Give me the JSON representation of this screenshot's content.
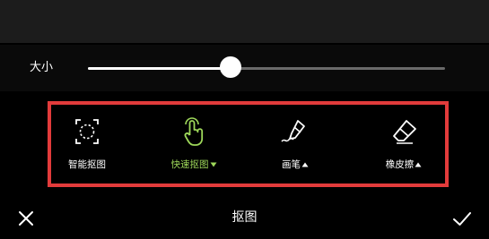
{
  "slider": {
    "label": "大小",
    "value": 0.4
  },
  "tools": [
    {
      "label": "智能抠图",
      "icon": "dashed-circle-selection-icon",
      "caret": "",
      "active": false
    },
    {
      "label": "快速抠图",
      "icon": "finger-tap-icon",
      "caret": "down",
      "active": true
    },
    {
      "label": "画笔",
      "icon": "brush-icon",
      "caret": "up",
      "active": false
    },
    {
      "label": "橡皮擦",
      "icon": "eraser-icon",
      "caret": "up",
      "active": false
    }
  ],
  "bottom_bar": {
    "title": "抠图",
    "close_icon": "close-icon",
    "confirm_icon": "checkmark-icon"
  },
  "colors": {
    "highlight_border": "#e23b3b",
    "active_tool": "#9ed85a",
    "background": "#000000"
  }
}
